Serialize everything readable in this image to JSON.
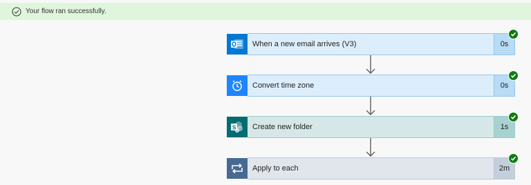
{
  "banner": {
    "message": "Your flow ran successfully.",
    "icon": "check-circle-icon"
  },
  "steps": [
    {
      "label": "When a new email arrives (V3)",
      "duration": "0s",
      "icon": "outlook-icon",
      "status": "succeeded",
      "colors": {
        "icon_bg": "#0078d4",
        "body_bg": "#dceefb",
        "border": "#92c5f0",
        "duration_bg": "#b8dbf6"
      }
    },
    {
      "label": "Convert time zone",
      "duration": "0s",
      "icon": "clock-icon",
      "status": "succeeded",
      "colors": {
        "icon_bg": "#1f85ff",
        "body_bg": "#dceefb",
        "border": "#92c5f0",
        "duration_bg": "#b8dbf6"
      }
    },
    {
      "label": "Create new folder",
      "duration": "1s",
      "icon": "sharepoint-icon",
      "status": "succeeded",
      "colors": {
        "icon_bg": "#036c70",
        "body_bg": "#d6e7e7",
        "border": "#9ccaca",
        "duration_bg": "#a7d2d1"
      }
    },
    {
      "label": "Apply to each",
      "duration": "2m",
      "icon": "loop-icon",
      "status": "succeeded",
      "colors": {
        "icon_bg": "#486991",
        "body_bg": "#e1e6ec",
        "border": "#bcc6d2",
        "duration_bg": "#c3cfdc"
      }
    }
  ],
  "status_icon": "success-check-icon",
  "connector_icon": "arrow-down-icon"
}
